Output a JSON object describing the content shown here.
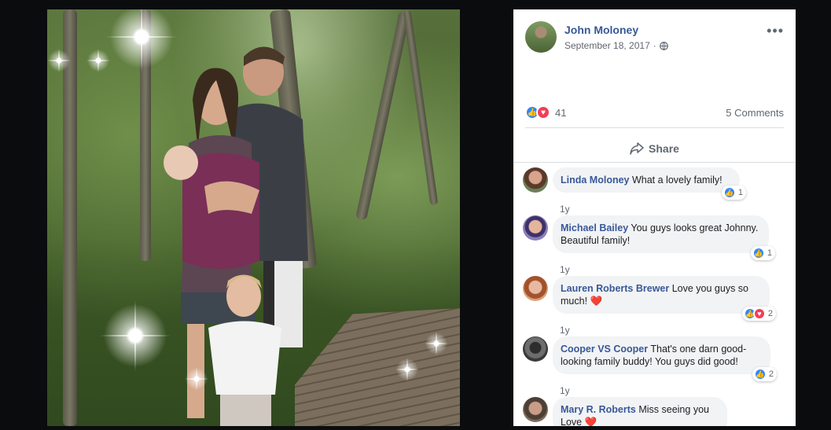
{
  "post": {
    "author": "John Moloney",
    "date": "September 18, 2017",
    "separator": "·",
    "privacy_icon": "globe-icon",
    "more_label": "•••"
  },
  "stats": {
    "reaction_count": "41",
    "comments_label": "5 Comments",
    "reactions": [
      "like",
      "love"
    ]
  },
  "actions": {
    "share_label": "Share"
  },
  "comments": [
    {
      "name": "Linda Moloney",
      "text": "What a lovely family!",
      "time": "1y",
      "reaction_count": "1",
      "reactions": [
        "like"
      ]
    },
    {
      "name": "Michael Bailey",
      "text": "You guys looks great Johnny. Beautiful family!",
      "time": "1y",
      "reaction_count": "1",
      "reactions": [
        "like"
      ]
    },
    {
      "name": "Lauren Roberts Brewer",
      "text": "Love you guys so much!",
      "emoji": "❤️",
      "time": "1y",
      "reaction_count": "2",
      "reactions": [
        "like",
        "love"
      ]
    },
    {
      "name": "Cooper VS Cooper",
      "text": "That's one darn good-looking family buddy! You guys did good!",
      "time": "1y",
      "reaction_count": "2",
      "reactions": [
        "like"
      ]
    },
    {
      "name": "Mary R. Roberts",
      "text": "Miss seeing you Love",
      "emoji": "❤️"
    }
  ],
  "colors": {
    "link": "#385898",
    "like": "#2d88ff",
    "love": "#f33e58",
    "bubble": "#f2f3f5"
  }
}
